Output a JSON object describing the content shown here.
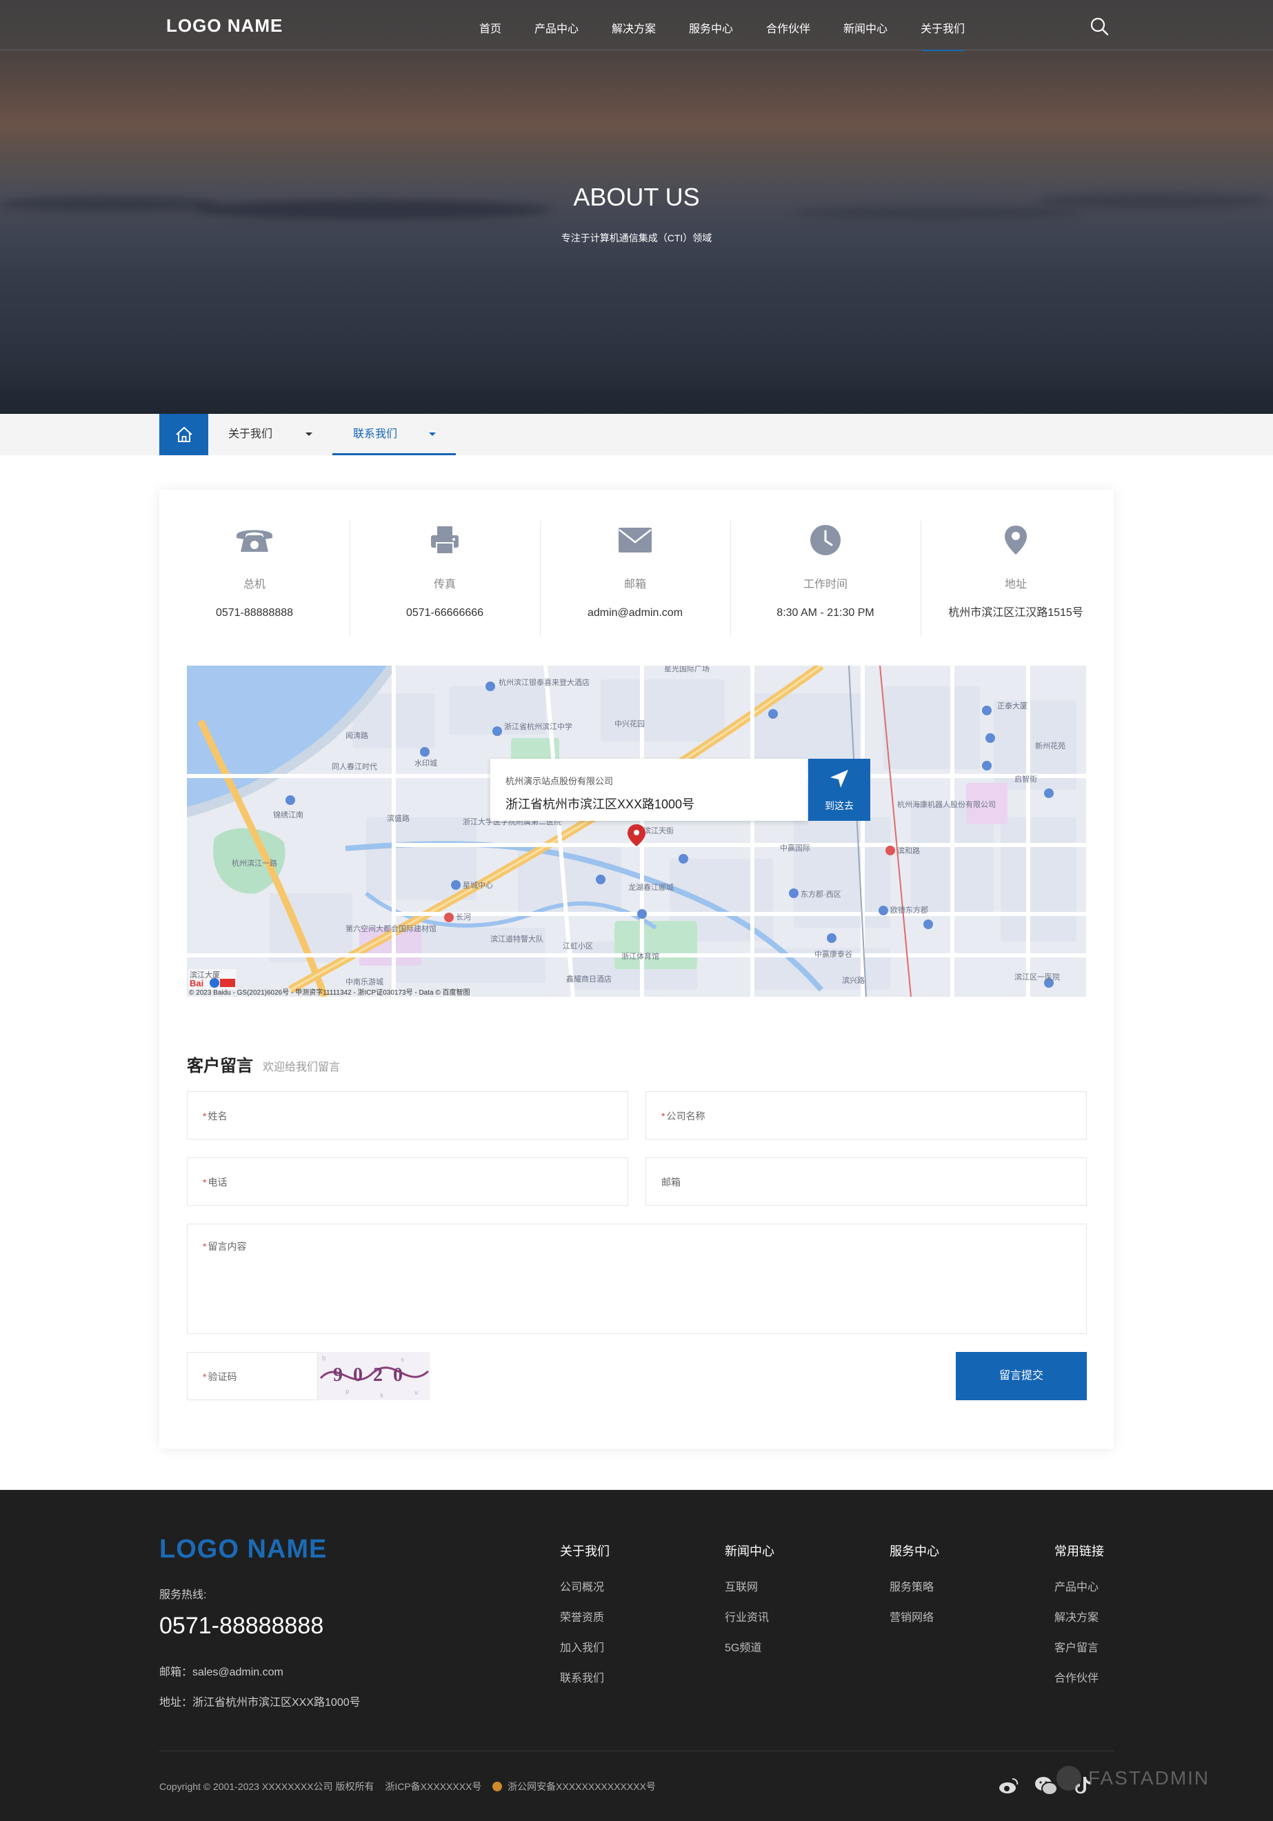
{
  "header": {
    "logo": "LOGO NAME",
    "nav": [
      "首页",
      "产品中心",
      "解决方案",
      "服务中心",
      "合作伙伴",
      "新闻中心",
      "关于我们"
    ],
    "active_nav": "关于我们",
    "search_icon": "search-icon"
  },
  "hero": {
    "title": "ABOUT US",
    "subtitle": "专注于计算机通信集成（CTI）领域"
  },
  "breadcrumb": {
    "home_icon": "home-icon",
    "items": [
      "关于我们",
      "联系我们"
    ],
    "active": "联系我们"
  },
  "contact": {
    "items": [
      {
        "icon": "phone-icon",
        "label": "总机",
        "value": "0571-88888888"
      },
      {
        "icon": "fax-icon",
        "label": "传真",
        "value": "0571-66666666"
      },
      {
        "icon": "mail-icon",
        "label": "邮箱",
        "value": "admin@admin.com"
      },
      {
        "icon": "clock-icon",
        "label": "工作时间",
        "value": "8:30 AM - 21:30 PM"
      },
      {
        "icon": "location-pin-icon",
        "label": "地址",
        "value": "杭州市滨江区江汉路1515号"
      }
    ]
  },
  "map": {
    "company": "杭州演示站点股份有限公司",
    "address": "浙江省杭州市滨江区XXX路1000号",
    "go_label": "到这去",
    "attribution": "© 2023 Baidu - GS(2021)6026号 - 甲测资字11111342 - 浙ICP证030173号 - Data © 百度智图",
    "brand": "Bai du 地图",
    "labels": [
      "杭州滨江银泰喜来登大酒店",
      "星光国际广场",
      "浙江省杭州滨江中学",
      "中兴花园",
      "闻涛路",
      "同人春江时代",
      "水印城",
      "锦绣江南",
      "滨盛路",
      "浙江大学医学院附属第二医院",
      "龙湖滨江天街",
      "龙湖春江郦城",
      "星城中心",
      "长河",
      "滨江道特警大队",
      "江虹小区",
      "浙江体育馆",
      "东方郡·西区",
      "中赢国际",
      "欧德东方郡",
      "中赢康泰谷",
      "杭州海康机器人股份有限公司",
      "滨和路",
      "启智街",
      "滨兴路",
      "新州花苑",
      "正泰大厦",
      "滨江区一医院",
      "第六空间大都会国际建材馆",
      "鑫耀商日酒店",
      "中南乐游城",
      "杭州滨江一路"
    ]
  },
  "form": {
    "title": "客户留言",
    "subtitle": "欢迎给我们留言",
    "fields": {
      "name": "姓名",
      "company": "公司名称",
      "phone": "电话",
      "email": "邮箱",
      "message": "留言内容",
      "captcha": "验证码"
    },
    "required_mark": "*",
    "captcha_text": "9 0 2 0",
    "submit": "留言提交"
  },
  "footer": {
    "logo": "LOGO NAME",
    "hotline_label": "服务热线:",
    "hotline": "0571-88888888",
    "email": "邮箱：sales@admin.com",
    "address": "地址：浙江省杭州市滨江区XXX路1000号",
    "columns": [
      {
        "title": "关于我们",
        "links": [
          "公司概况",
          "荣誉资质",
          "加入我们",
          "联系我们"
        ]
      },
      {
        "title": "新闻中心",
        "links": [
          "互联网",
          "行业资讯",
          "5G频道"
        ]
      },
      {
        "title": "服务中心",
        "links": [
          "服务策略",
          "营销网络"
        ]
      },
      {
        "title": "常用链接",
        "links": [
          "产品中心",
          "解决方案",
          "客户留言",
          "合作伙伴"
        ]
      }
    ],
    "copyright": "Copyright © 2001-2023 XXXXXXXX公司 版权所有",
    "icp": "浙ICP备XXXXXXXX号",
    "police": "浙公网安备XXXXXXXXXXXXXX号",
    "social_icons": [
      "weibo-icon",
      "wechat-icon",
      "tiktok-icon"
    ],
    "watermark": "FASTADMIN"
  },
  "colors": {
    "primary": "#1565b5",
    "footer_bg": "#1f1f20",
    "required": "#e03b3b"
  }
}
